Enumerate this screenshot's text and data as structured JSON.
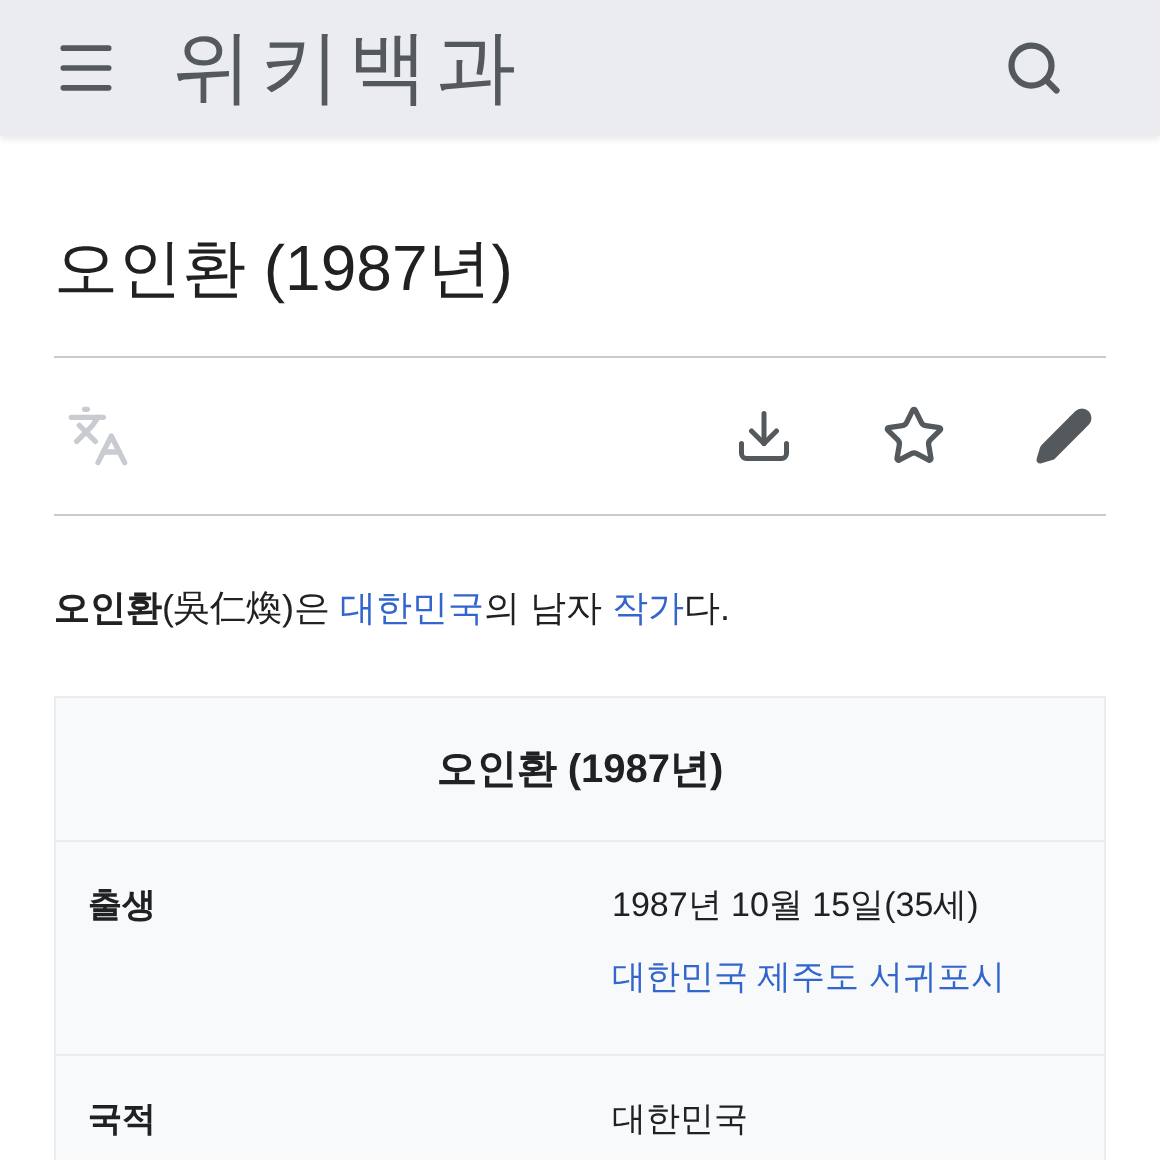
{
  "header": {
    "logo": "위키백과"
  },
  "article": {
    "title": "오인환 (1987년)"
  },
  "lead": [
    {
      "kind": "bold",
      "text": "오인환"
    },
    {
      "kind": "text",
      "text": "(吳仁煥)은 "
    },
    {
      "kind": "link",
      "text": "대한민국"
    },
    {
      "kind": "text",
      "text": "의 남자 "
    },
    {
      "kind": "link",
      "text": "작가"
    },
    {
      "kind": "text",
      "text": "다."
    }
  ],
  "infobox": {
    "title": "오인환 (1987년)",
    "rows": [
      {
        "label": "출생",
        "lines": [
          {
            "kind": "text",
            "text": "1987년 10월 15일(35세)"
          },
          {
            "kind": "link",
            "text": "대한민국 제주도 서귀포시"
          }
        ]
      },
      {
        "label": "국적",
        "lines": [
          {
            "kind": "text",
            "text": "대한민국"
          }
        ]
      }
    ]
  }
}
